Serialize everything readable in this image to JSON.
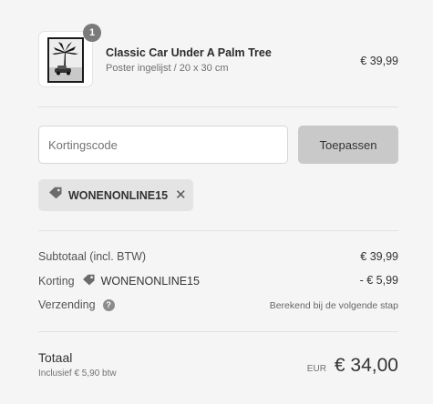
{
  "product": {
    "title": "Classic Car Under A Palm Tree",
    "subtitle": "Poster ingelijst / 20 x 30 cm",
    "price": "€ 39,99",
    "quantity": "1"
  },
  "discount": {
    "placeholder": "Kortingscode",
    "apply_label": "Toepassen",
    "applied_code": "WONENONLINE15",
    "remove_symbol": "✕"
  },
  "summary": {
    "subtotal_label": "Subtotaal (incl. BTW)",
    "subtotal_value": "€ 39,99",
    "discount_label": "Korting",
    "discount_code": "WONENONLINE15",
    "discount_value": "- € 5,99",
    "shipping_label": "Verzending",
    "shipping_help": "?",
    "shipping_value": "Berekend bij de volgende stap"
  },
  "total": {
    "label": "Totaal",
    "tax_note": "Inclusief € 5,90 btw",
    "currency": "EUR",
    "amount": "€ 34,00"
  },
  "icons": {
    "tag": "tag-icon",
    "close": "close-icon",
    "help": "help-icon"
  }
}
